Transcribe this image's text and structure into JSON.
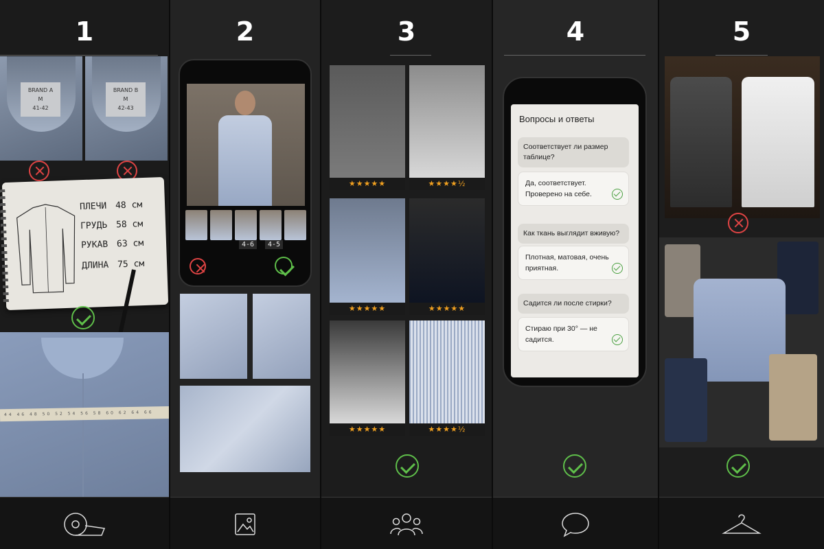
{
  "steps": [
    {
      "number": "1"
    },
    {
      "number": "2"
    },
    {
      "number": "3"
    },
    {
      "number": "4"
    },
    {
      "number": "5"
    }
  ],
  "step1": {
    "tag_a": {
      "brand": "BRAND A",
      "size": "M",
      "range": "41-42"
    },
    "tag_b": {
      "brand": "BRAND B",
      "size": "M",
      "range": "42-43"
    },
    "measurements": [
      {
        "label": "ПЛЕЧИ",
        "value": "48 см"
      },
      {
        "label": "ГРУДЬ",
        "value": "58 см"
      },
      {
        "label": "РУКАВ",
        "value": "63 см"
      },
      {
        "label": "ДЛИНА",
        "value": "75 см"
      }
    ]
  },
  "step2": {
    "size_chips": [
      "4-6",
      "4-5"
    ]
  },
  "step3": {
    "reviews": [
      {
        "rating": 5
      },
      {
        "rating": 4.5
      },
      {
        "rating": 5
      },
      {
        "rating": 5
      },
      {
        "rating": 5
      },
      {
        "rating": 4.5
      }
    ]
  },
  "step4": {
    "title": "Вопросы и ответы",
    "qa": [
      {
        "q": "Соответствует ли размер таблице?",
        "a": "Да, соответствует. Проверено на себе."
      },
      {
        "q": "Как ткань выглядит вживую?",
        "a": "Плотная, матовая, очень приятная."
      },
      {
        "q": "Садится ли после стирки?",
        "a": "Стираю при 30° — не садится."
      }
    ]
  },
  "icons": [
    "measuring-tape-icon",
    "image-icon",
    "people-icon",
    "speech-bubble-icon",
    "hanger-icon"
  ],
  "colors": {
    "check": "#5fbf4a",
    "cross": "#e04444",
    "star": "#f0a020"
  }
}
